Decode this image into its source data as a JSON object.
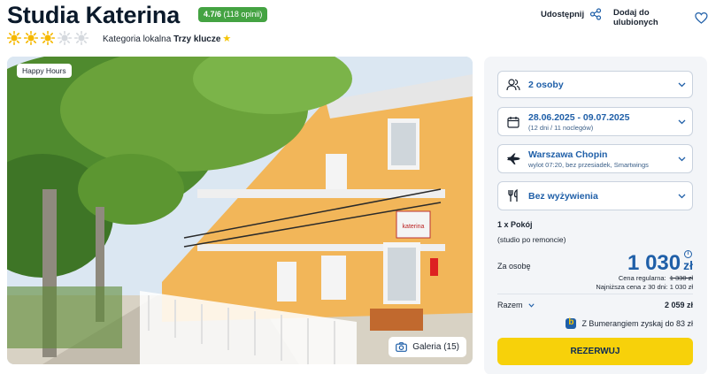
{
  "hotel": {
    "name": "Studia Katerina",
    "rating": "4.7/6",
    "rating_count": "(118 opinii)",
    "sun_rating": 3,
    "sun_max": 5,
    "category_prefix": "Kategoria lokalna",
    "category_value": "Trzy klucze"
  },
  "actions": {
    "share_label": "Udostępnij",
    "favorite_label": "Dodaj do ulubionych"
  },
  "photo": {
    "badge": "Happy Hours",
    "gallery_label": "Galeria (15)",
    "sign_text": "katerina"
  },
  "booking": {
    "persons": "2 osoby",
    "dates": "28.06.2025 - 09.07.2025",
    "dates_sub": "(12 dni / 11 noclegów)",
    "departure": "Warszawa Chopin",
    "departure_sub": "wylot 07:20, bez przesiadek, Smartwings",
    "board": "Bez wyżywienia",
    "room_count": "1 x Pokój",
    "room_note": "(studio po remoncie)",
    "per_person_label": "Za osobę",
    "price": "1 030",
    "currency": "zł",
    "regular_label": "Cena regularna:",
    "regular_price": "1 330 zł",
    "lowest_label": "Najniższa cena z 30 dni: 1 030 zł",
    "total_label": "Razem",
    "total_value": "2 059 zł",
    "bumerang_text": "Z Bumerangiem zyskaj do 83 zł",
    "reserve_label": "REZERWUJ"
  },
  "colors": {
    "accent_blue": "#1f5fa8",
    "rating_green": "#44a342",
    "reserve_yellow": "#f7d10a",
    "sun_active": "#f5b800",
    "sun_inactive": "#d5d9de"
  }
}
